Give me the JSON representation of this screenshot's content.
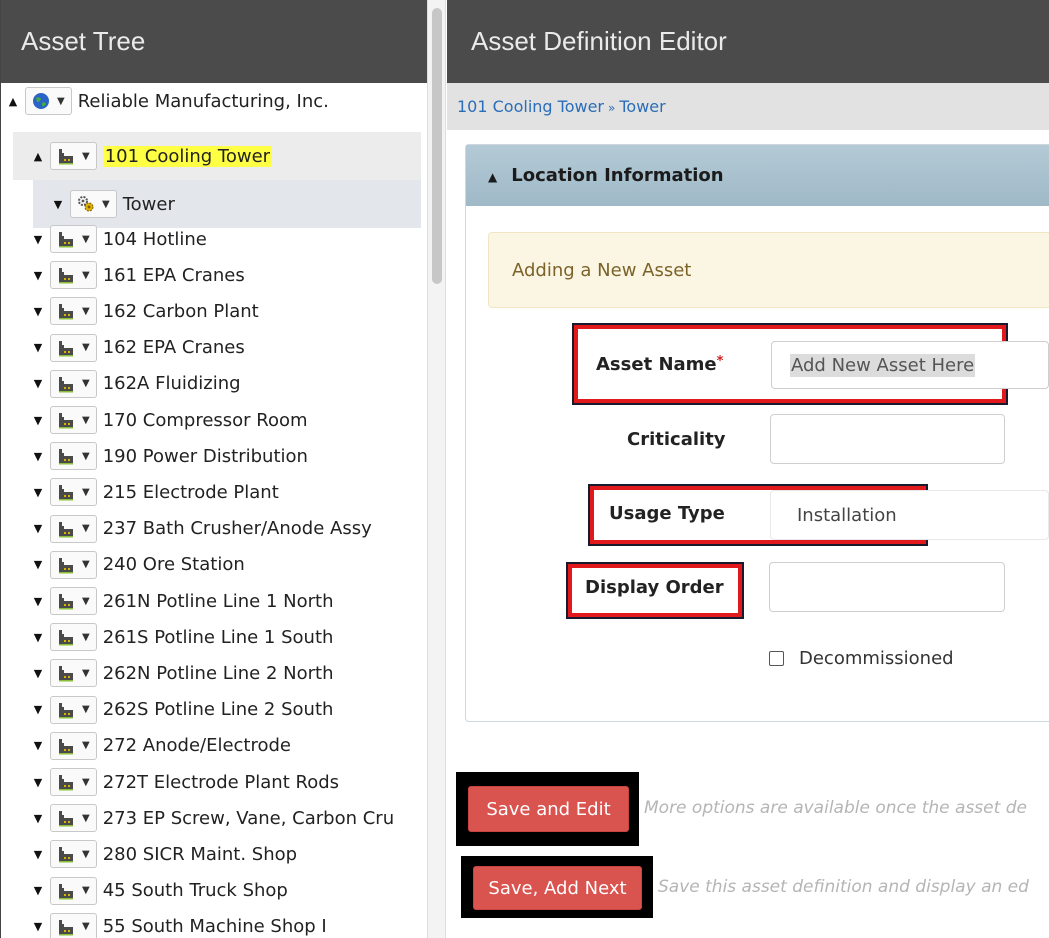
{
  "left_panel": {
    "title": "Asset Tree",
    "items": [
      {
        "label": "Reliable Manufacturing, Inc.",
        "icon": "globe-icon",
        "expand": "up",
        "level": 0
      },
      {
        "label": "101 Cooling Tower",
        "icon": "factory-icon",
        "expand": "up",
        "level": 1,
        "highlighted": true
      },
      {
        "label": "Tower",
        "icon": "gears-icon",
        "expand": "down",
        "level": 2,
        "selected": true
      },
      {
        "label": "104 Hotline",
        "icon": "factory-icon",
        "expand": "down",
        "level": 1
      },
      {
        "label": "161 EPA Cranes",
        "icon": "factory-icon",
        "expand": "down",
        "level": 1
      },
      {
        "label": "162 Carbon Plant",
        "icon": "factory-icon",
        "expand": "down",
        "level": 1
      },
      {
        "label": "162 EPA Cranes",
        "icon": "factory-icon",
        "expand": "down",
        "level": 1
      },
      {
        "label": "162A Fluidizing",
        "icon": "factory-icon",
        "expand": "down",
        "level": 1
      },
      {
        "label": "170 Compressor Room",
        "icon": "factory-icon",
        "expand": "down",
        "level": 1
      },
      {
        "label": "190 Power Distribution",
        "icon": "factory-icon",
        "expand": "down",
        "level": 1
      },
      {
        "label": "215 Electrode Plant",
        "icon": "factory-icon",
        "expand": "down",
        "level": 1
      },
      {
        "label": "237 Bath Crusher/Anode Assy",
        "icon": "factory-icon",
        "expand": "down",
        "level": 1
      },
      {
        "label": "240 Ore Station",
        "icon": "factory-icon",
        "expand": "down",
        "level": 1
      },
      {
        "label": "261N Potline Line 1 North",
        "icon": "factory-icon",
        "expand": "down",
        "level": 1
      },
      {
        "label": "261S Potline Line 1 South",
        "icon": "factory-icon",
        "expand": "down",
        "level": 1
      },
      {
        "label": "262N Potline Line 2 North",
        "icon": "factory-icon",
        "expand": "down",
        "level": 1
      },
      {
        "label": "262S Potline Line 2 South",
        "icon": "factory-icon",
        "expand": "down",
        "level": 1
      },
      {
        "label": "272 Anode/Electrode",
        "icon": "factory-icon",
        "expand": "down",
        "level": 1
      },
      {
        "label": "272T Electrode Plant Rods",
        "icon": "factory-icon",
        "expand": "down",
        "level": 1
      },
      {
        "label": "273 EP Screw, Vane, Carbon Cru",
        "icon": "factory-icon",
        "expand": "down",
        "level": 1
      },
      {
        "label": "280 SICR Maint. Shop",
        "icon": "factory-icon",
        "expand": "down",
        "level": 1
      },
      {
        "label": "45 South Truck Shop",
        "icon": "factory-icon",
        "expand": "down",
        "level": 1
      },
      {
        "label": "55 South Machine Shop I",
        "icon": "factory-icon",
        "expand": "down",
        "level": 1
      }
    ]
  },
  "right_panel": {
    "title": "Asset Definition Editor",
    "breadcrumb": {
      "first": "101 Cooling Tower",
      "sep": "»",
      "second": "Tower"
    },
    "section_title": "Location Information",
    "notice": "Adding a New Asset",
    "form": {
      "asset_name_label": "Asset Name",
      "asset_name_required": "*",
      "asset_name_value": "Add New Asset Here",
      "criticality_label": "Criticality",
      "criticality_value": "",
      "usage_type_label": "Usage Type",
      "usage_type_value": "Installation",
      "display_order_label": "Display Order",
      "display_order_value": "",
      "decommissioned_label": "Decommissioned"
    },
    "buttons": {
      "save_edit": "Save and Edit",
      "save_edit_hint": "More options are available once the asset de",
      "save_next": "Save, Add Next",
      "save_next_hint": "Save this asset definition and display an ed"
    }
  },
  "colors": {
    "header_bg": "#4b4b4b",
    "accent_red": "#d9534f",
    "highlight_yellow": "#ffff44",
    "annotation_red": "#e1191c",
    "link_blue": "#2a6db8"
  }
}
